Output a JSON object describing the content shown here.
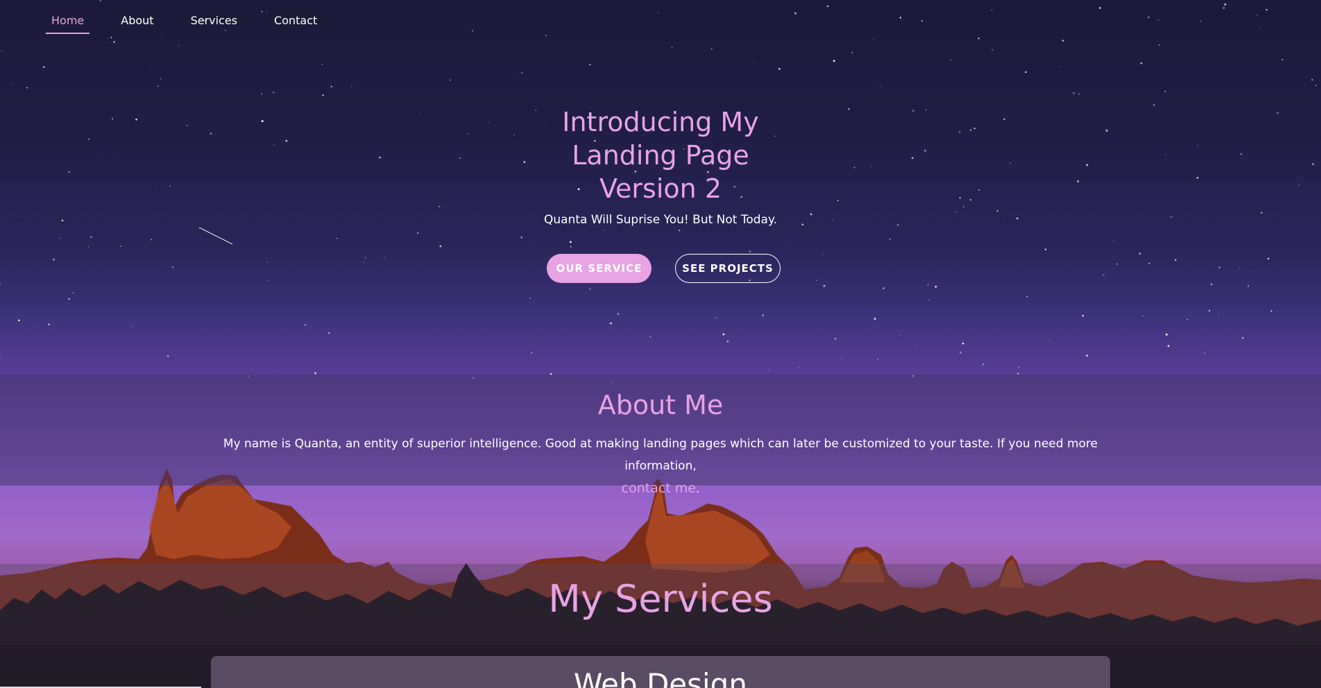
{
  "nav": {
    "items": [
      {
        "label": "Home",
        "active": true
      },
      {
        "label": "About",
        "active": false
      },
      {
        "label": "Services",
        "active": false
      },
      {
        "label": "Contact",
        "active": false
      }
    ]
  },
  "hero": {
    "title_lines": [
      "Introducing My",
      "Landing Page",
      "Version 2"
    ],
    "subtitle": "Quanta Will Suprise You! But Not Today.",
    "primary_button": "OUR SERVICE",
    "secondary_button": "SEE PROJECTS"
  },
  "about": {
    "title": "About Me",
    "text": "My name is Quanta, an entity of superior intelligence. Good at making landing pages which can later be customized to your taste. If you need more information,",
    "link_text": "contact me",
    "link_suffix": "."
  },
  "services": {
    "title": "My Services",
    "cards": [
      {
        "title": "Web Design"
      }
    ]
  },
  "colors": {
    "accent": "#e8a3e3",
    "text": "#ffffff",
    "sky_top": "#1c1a37",
    "sky_purple": "#8b5cc9"
  }
}
